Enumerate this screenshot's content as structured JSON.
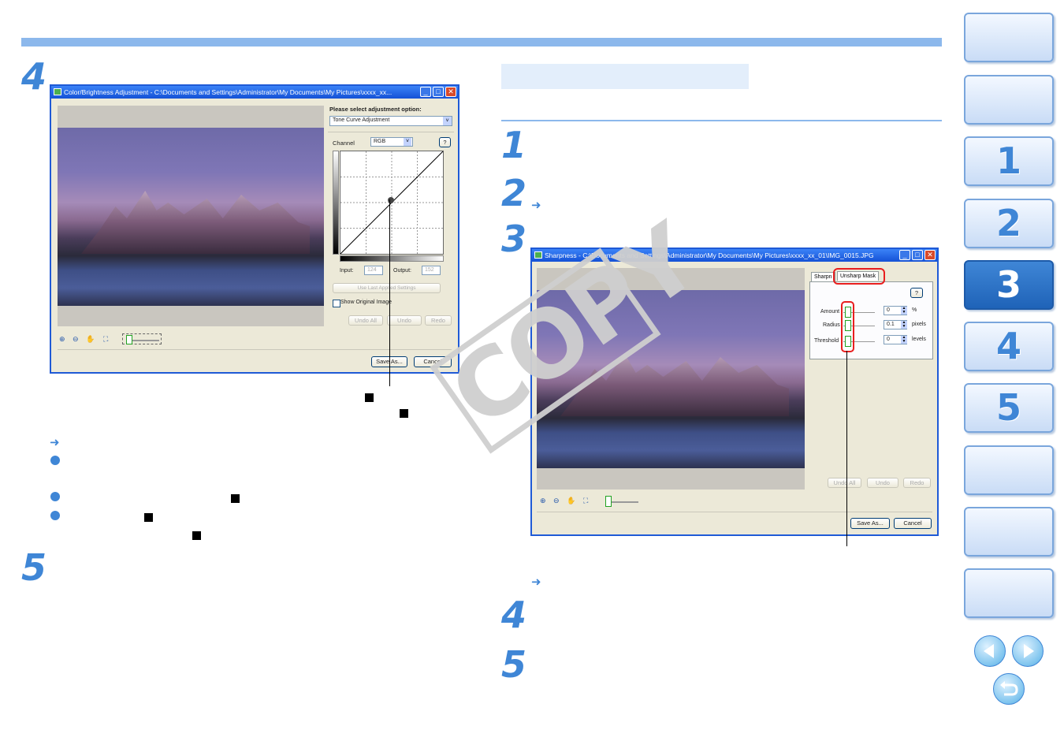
{
  "header_bar": {
    "color": "#8cb8ec"
  },
  "left_column": {
    "step4": "4",
    "step5": "5",
    "window": {
      "title": "Color/Brightness Adjustment - C:\\Documents and Settings\\Administrator\\My Documents\\My Pictures\\xxxx_xx...",
      "adjust_prompt": "Please select adjustment option:",
      "adjust_option": "Tone Curve Adjustment",
      "channel_label": "Channel",
      "channel_value": "RGB",
      "help": "?",
      "input_label": "Input:",
      "input_value": "124",
      "output_label": "Output:",
      "output_value": "152",
      "use_last": "Use Last Applied Settings",
      "show_original": "Show Original Image",
      "undo_all": "Undo All",
      "undo": "Undo",
      "redo": "Redo",
      "save_as": "Save As...",
      "cancel": "Cancel"
    }
  },
  "right_column": {
    "steps": [
      "1",
      "2",
      "3",
      "4",
      "5"
    ],
    "window": {
      "title": "Sharpness - C:\\Documents and Settings\\Administrator\\My Documents\\My Pictures\\xxxx_xx_01\\IMG_0015.JPG",
      "tab_sharpness": "Sharpn",
      "tab_unsharp": "Unsharp Mask",
      "help": "?",
      "amount_label": "Amount",
      "amount_value": "0",
      "amount_unit": "%",
      "radius_label": "Radius",
      "radius_value": "0.1",
      "radius_unit": "pixels",
      "threshold_label": "Threshold",
      "threshold_value": "0",
      "threshold_unit": "levels",
      "undo_all": "Undo All",
      "undo": "Undo",
      "redo": "Redo",
      "save_as": "Save As...",
      "cancel": "Cancel"
    }
  },
  "watermark": "COPY",
  "sidebar": {
    "buttons": [
      "",
      "",
      "1",
      "2",
      "3",
      "4",
      "5",
      "",
      "",
      ""
    ],
    "active": "3"
  },
  "colors": {
    "accent": "#3f86d6",
    "highlight": "#e81e1e"
  }
}
